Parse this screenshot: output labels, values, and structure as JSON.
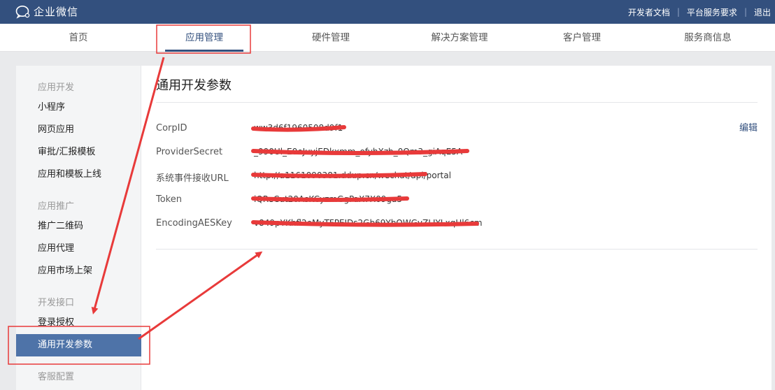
{
  "topbar": {
    "logo_text": "企业微信",
    "links": [
      "开发者文档",
      "平台服务要求",
      "退出"
    ]
  },
  "nav": {
    "items": [
      "首页",
      "应用管理",
      "硬件管理",
      "解决方案管理",
      "客户管理",
      "服务商信息"
    ],
    "active": "应用管理"
  },
  "sidebar": {
    "groups": [
      {
        "title": "应用开发",
        "items": [
          "小程序",
          "网页应用",
          "审批/汇报模板",
          "应用和模板上线"
        ]
      },
      {
        "title": "应用推广",
        "items": [
          "推广二维码",
          "应用代理",
          "应用市场上架"
        ]
      },
      {
        "title": "开发接口",
        "items": [
          "登录授权",
          "通用开发参数"
        ]
      },
      {
        "title": "客服配置",
        "items": []
      }
    ],
    "active_item": "通用开发参数"
  },
  "main": {
    "title": "通用开发参数",
    "edit_label": "编辑",
    "params": [
      {
        "label": "CorpID",
        "value": "ww3d6f1960508d9f1"
      },
      {
        "label": "ProviderSecret",
        "value": "_990Ul_E0eJuyjEDkxmm_ofyhXzb_0Qm3_giAqE5A"
      },
      {
        "label": "系统事件接收URL",
        "value": "http://a1161090381.ddup.cn/wechat/api/portal"
      },
      {
        "label": "Token",
        "value": "iQReCut20AsKCyzmGgPaX7X09ga5"
      },
      {
        "label": "EncodingAESKey",
        "value": "v849pYKhfl2eMyTFPEIDs2Gb69YbOWGvZLIYLxqHl6cm"
      }
    ]
  },
  "colors": {
    "topbar": "#33507e",
    "active_sidebar": "#4e73a8",
    "annotation_red": "#e83a3a"
  }
}
